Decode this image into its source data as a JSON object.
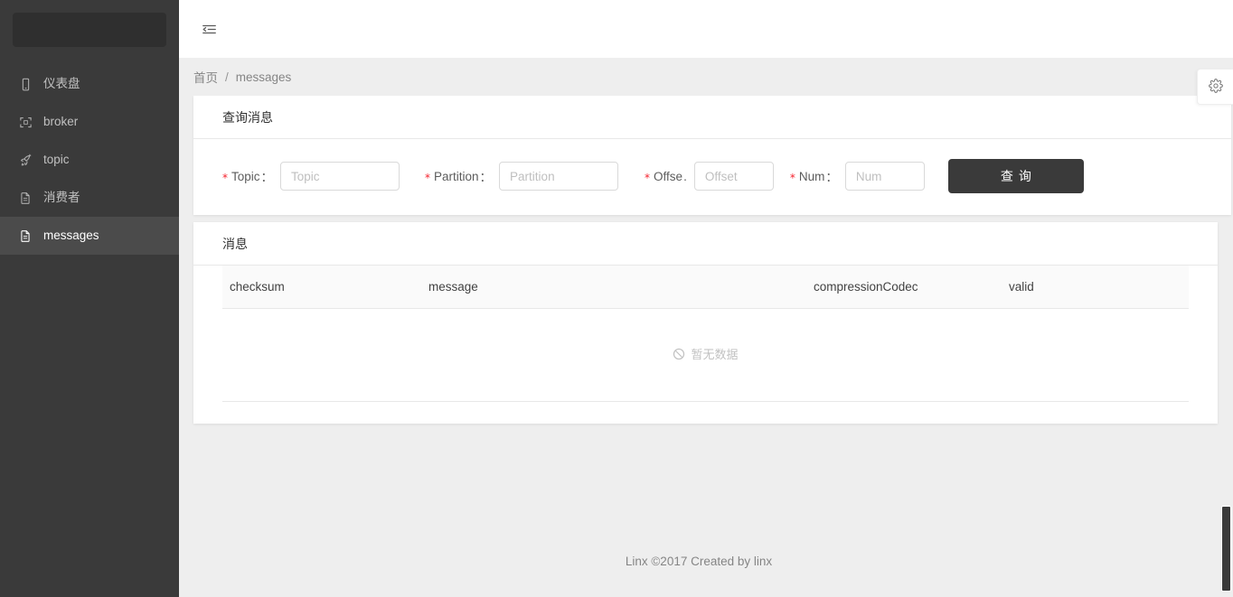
{
  "sidebar": {
    "logo_placeholder": "",
    "items": [
      {
        "label": "仪表盘",
        "icon": "mobile-icon",
        "active": false
      },
      {
        "label": "broker",
        "icon": "scan-icon",
        "active": false
      },
      {
        "label": "topic",
        "icon": "rocket-icon",
        "active": false
      },
      {
        "label": "消费者",
        "icon": "file-icon",
        "active": false
      },
      {
        "label": "messages",
        "icon": "file-icon",
        "active": true
      }
    ]
  },
  "topbar": {
    "fold_icon": "menu-fold-icon"
  },
  "breadcrumb": {
    "home": "首页",
    "separator": "/",
    "current": "messages"
  },
  "query_card": {
    "title": "查询消息",
    "fields": [
      {
        "label": "Topic",
        "colon": "：",
        "placeholder": "Topic",
        "value": "",
        "required": true
      },
      {
        "label": "Partition",
        "colon": "：",
        "placeholder": "Partition",
        "value": "",
        "required": true
      },
      {
        "label": "Offse",
        "colon": ".",
        "placeholder": "Offset",
        "value": "",
        "required": true
      },
      {
        "label": "Num",
        "colon": "：",
        "placeholder": "Num",
        "value": "",
        "required": true
      }
    ],
    "submit_label": "查询"
  },
  "messages_card": {
    "title": "消息",
    "columns": [
      "checksum",
      "message",
      "compressionCodec",
      "valid"
    ],
    "rows": [],
    "empty_text": "暂无数据"
  },
  "settings": {
    "icon": "gear-icon"
  },
  "footer": {
    "text": "Linx ©2017 Created by linx"
  },
  "colors": {
    "sidebar_bg": "#3a3a3a",
    "sidebar_active_bg": "#4b4b4b",
    "page_bg": "#eeeeee",
    "card_bg": "#ffffff",
    "accent_required": "#f5222d",
    "button_bg": "#3a3a3a"
  }
}
